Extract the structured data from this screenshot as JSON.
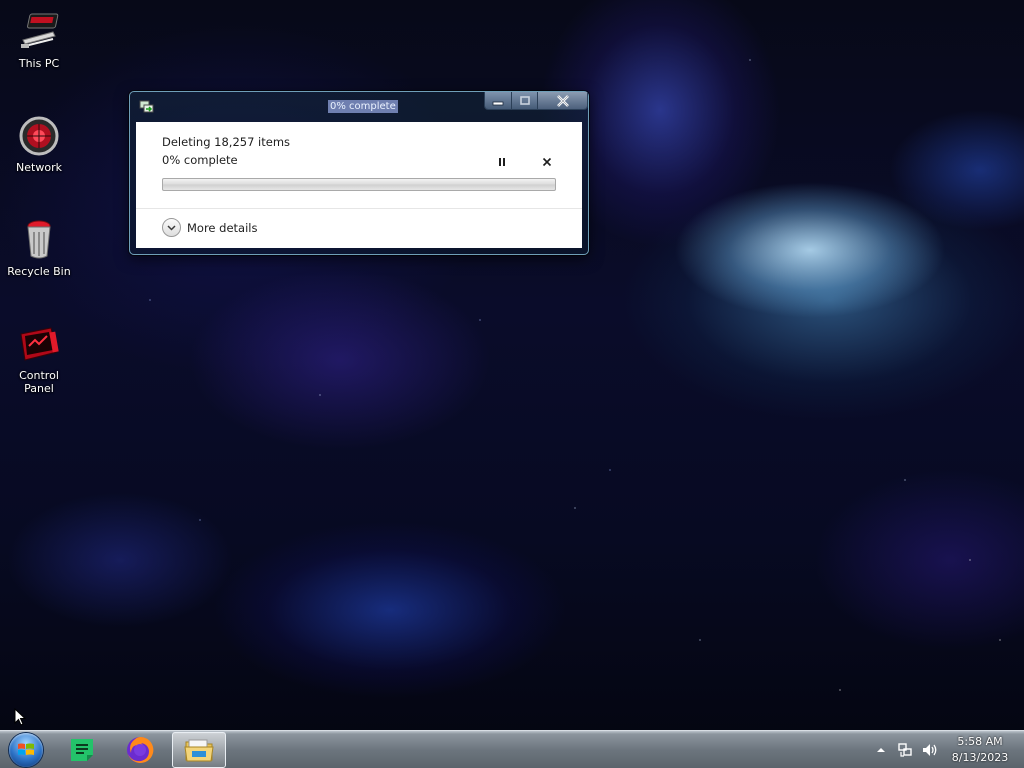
{
  "desktop": {
    "icons": [
      {
        "label": "This PC",
        "icon": "computer-icon"
      },
      {
        "label": "Network",
        "icon": "network-icon"
      },
      {
        "label": "Recycle Bin",
        "icon": "recycle-bin-icon"
      },
      {
        "label": "Control Panel",
        "icon": "control-panel-icon"
      }
    ]
  },
  "dialog": {
    "title": "0% complete",
    "operation_text": "Deleting 18,257 items",
    "percent_text": "0% complete",
    "progress_fraction": 0.0,
    "more_details_label": "More details",
    "colors": {
      "accent": "#17b317",
      "window_border": "#6f9fb8"
    }
  },
  "taskbar": {
    "items": [
      {
        "name": "start",
        "icon": "windows-logo-icon"
      },
      {
        "name": "notes",
        "icon": "notes-app-icon"
      },
      {
        "name": "firefox",
        "icon": "firefox-icon"
      },
      {
        "name": "file-explorer",
        "icon": "folder-icon",
        "active": true
      }
    ],
    "tray": {
      "icons": [
        "show-hidden-icons-arrow",
        "network-icon",
        "volume-icon"
      ],
      "time": "5:58 AM",
      "date": "8/13/2023"
    }
  }
}
